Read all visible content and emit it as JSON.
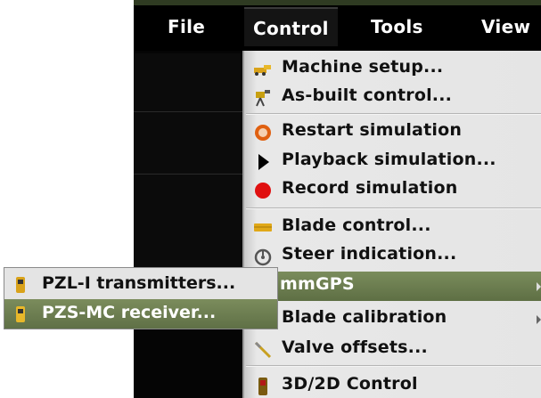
{
  "menubar": {
    "items": [
      {
        "label": "File"
      },
      {
        "label": "Control"
      },
      {
        "label": "Tools"
      },
      {
        "label": "View"
      }
    ]
  },
  "control_menu": {
    "items": [
      {
        "label": "Machine setup...",
        "icon": "machine-icon"
      },
      {
        "label": "As-built control...",
        "icon": "survey-icon"
      },
      {
        "label": "Restart simulation",
        "icon": "restart-icon"
      },
      {
        "label": "Playback simulation...",
        "icon": "play-icon"
      },
      {
        "label": "Record simulation",
        "icon": "record-icon"
      },
      {
        "label": "Blade control...",
        "icon": "blade-icon"
      },
      {
        "label": "Steer indication...",
        "icon": "steer-icon"
      },
      {
        "label": "mmGPS",
        "icon": "none",
        "submenu": true
      },
      {
        "label": "Blade calibration",
        "icon": "none",
        "submenu": true
      },
      {
        "label": "Valve offsets...",
        "icon": "wrench-icon"
      },
      {
        "label": "3D/2D Control",
        "icon": "device-icon"
      }
    ]
  },
  "mmgps_submenu": {
    "items": [
      {
        "label": "PZL-I transmitters...",
        "icon": "transmitter-icon"
      },
      {
        "label": "PZS-MC receiver...",
        "icon": "receiver-icon"
      }
    ]
  },
  "colors": {
    "menubar_bg": "#000000",
    "menu_bg": "#e5e5e5",
    "highlight": "#6b7d50",
    "record_red": "#e01010",
    "restart_orange": "#e06010"
  }
}
